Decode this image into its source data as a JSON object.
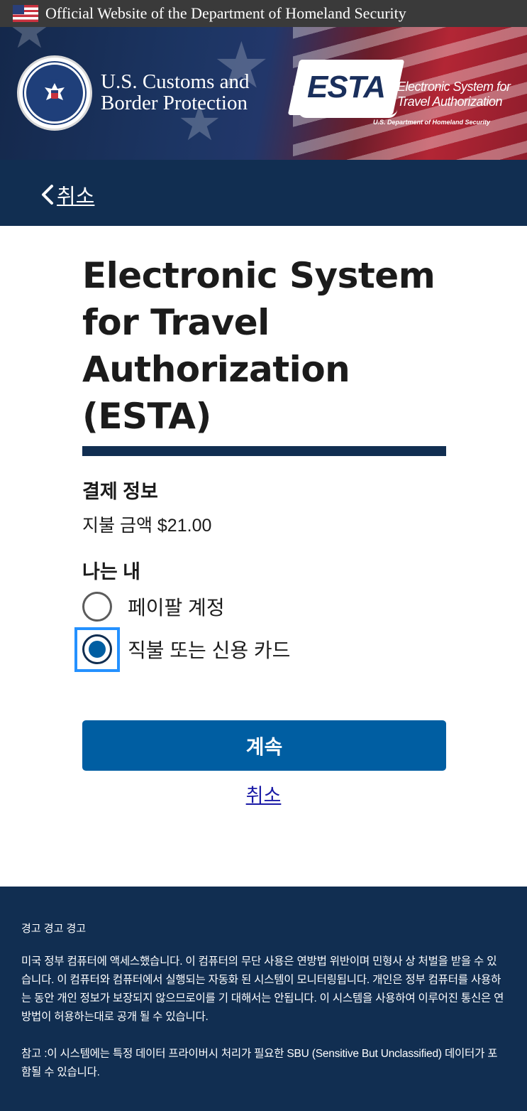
{
  "banner": {
    "text": "Official Website of the Department of Homeland Security"
  },
  "header": {
    "agency_line1": "U.S. Customs and",
    "agency_line2": "Border Protection",
    "esta_logo": "ESTA",
    "esta_sub_line1": "Electronic System for",
    "esta_sub_line2": "Travel Authorization",
    "esta_dept": "U.S. Department of Homeland Security"
  },
  "nav": {
    "back_label": "취소"
  },
  "main": {
    "title_lines": [
      "Electronic System",
      "for Travel",
      "Authorization",
      "(ESTA)"
    ],
    "section_heading": "결제 정보",
    "amount_label": "지불 금액",
    "amount_value": "$21.00",
    "radio_legend": "나는 내",
    "options": [
      {
        "label": "페이팔 계정",
        "selected": false
      },
      {
        "label": "직불 또는 신용 카드",
        "selected": true
      }
    ],
    "continue_label": "계속",
    "cancel_label": "취소"
  },
  "footer": {
    "warning": "경고 경고 경고",
    "paragraph1": "미국 정부 컴퓨터에 액세스했습니다. 이 컴퓨터의 무단 사용은 연방법 위반이며 민형사 상 처벌을 받을 수 있습니다. 이 컴퓨터와 컴퓨터에서 실행되는 자동화 된 시스템이 모니터링됩니다. 개인은 정부 컴퓨터를 사용하는 동안 개인 정보가 보장되지 않으므로이를 기 대해서는 안됩니다. 이 시스템을 사용하여 이루어진 통신은 연방법이 허용하는대로 공개 될 수 있습니다.",
    "paragraph2": "참고 :이 시스템에는 특정 데이터 프라이버시 처리가 필요한 SBU (Sensitive But Unclassified) 데이터가 포함될 수 있습니다."
  },
  "colors": {
    "navy": "#112e51",
    "primary_button": "#005ea2",
    "focus": "#2491ff",
    "banner_bg": "#3a3a3a"
  },
  "icons": [
    "us-flag-icon",
    "dhs-seal-icon",
    "chevron-left-icon",
    "radio-unchecked-icon",
    "radio-checked-icon"
  ]
}
